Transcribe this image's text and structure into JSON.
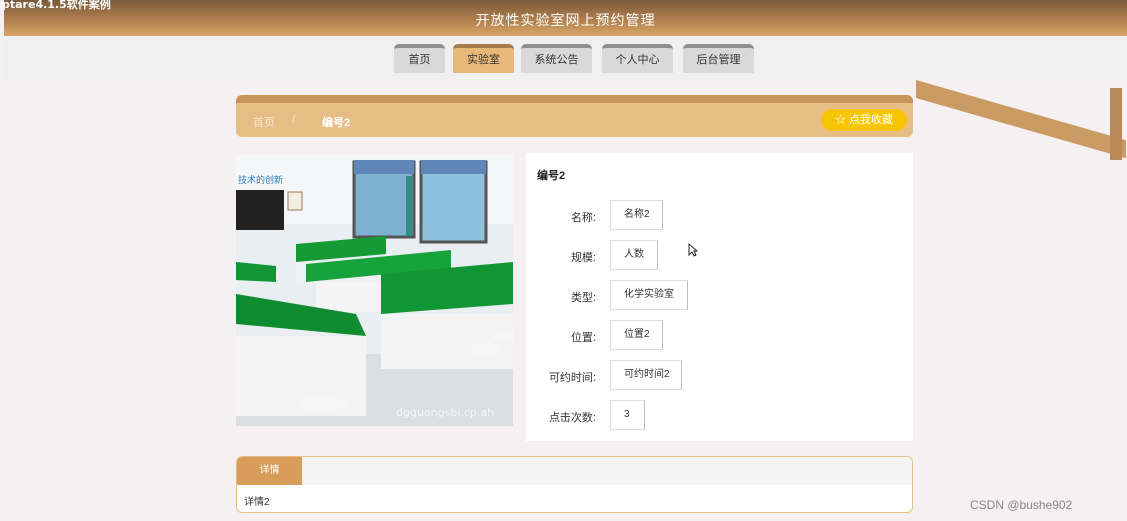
{
  "window": {
    "corner_text": "ptare4.1.5软件案例"
  },
  "header": {
    "site_title": "开放性实验室网上预约管理"
  },
  "nav": {
    "items": [
      "首页",
      "实验室",
      "系统公告",
      "个人中心",
      "后台管理"
    ],
    "active_index": 1
  },
  "breadcrumb": {
    "home": "首页",
    "separator": "/",
    "current": "编号2"
  },
  "actions": {
    "favorite_label": "☆ 点我收藏"
  },
  "lab": {
    "card_title": "编号2",
    "photo_caption": "技术的创新",
    "photo_watermark": "dgguangsbi.cp.ah",
    "fields": [
      {
        "label": "名称:",
        "value": "名称2"
      },
      {
        "label": "规模:",
        "value": "人数"
      },
      {
        "label": "类型:",
        "value": "化学实验室"
      },
      {
        "label": "位置:",
        "value": "位置2"
      },
      {
        "label": "可约时间:",
        "value": "可约时间2"
      },
      {
        "label": "点击次数:",
        "value": "3"
      }
    ]
  },
  "details": {
    "tab_label": "详情",
    "content": "详情2"
  },
  "watermark": "CSDN @bushe902",
  "colors": {
    "header_brown": "#b07f4e",
    "accent_tan": "#e7bd86",
    "favorite_yellow": "#f7c600",
    "active_tab": "#e8b77a"
  }
}
